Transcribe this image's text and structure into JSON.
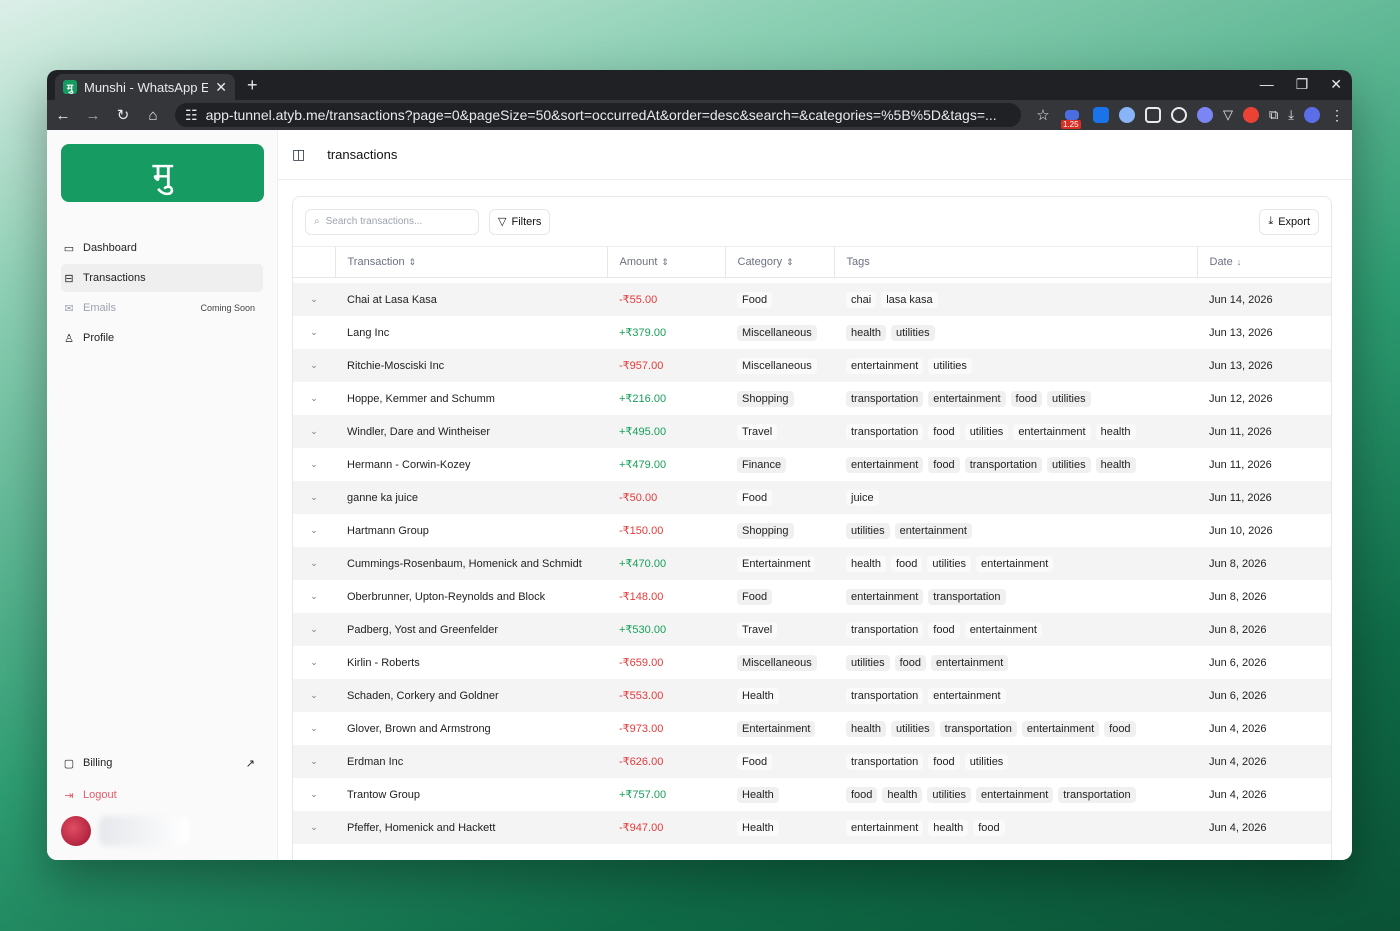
{
  "browser": {
    "tab_title": "Munshi - WhatsApp E",
    "favicon_letter": "मु",
    "url": "app-tunnel.atyb.me/transactions?page=0&pageSize=50&sort=occurredAt&order=desc&search=&categories=%5B%5D&tags=...",
    "ext_badge": "1.25"
  },
  "sidebar": {
    "logo": "मु",
    "items": [
      {
        "label": "Dashboard",
        "icon": "wallet-icon"
      },
      {
        "label": "Transactions",
        "icon": "receipt-icon"
      },
      {
        "label": "Emails",
        "icon": "mail-icon",
        "badge": "Coming Soon"
      },
      {
        "label": "Profile",
        "icon": "user-icon"
      }
    ],
    "billing": "Billing",
    "logout": "Logout"
  },
  "header": {
    "title": "transactions"
  },
  "toolbar": {
    "search_placeholder": "Search transactions...",
    "filters": "Filters",
    "export": "Export"
  },
  "table": {
    "columns": [
      "Transaction",
      "Amount",
      "Category",
      "Tags",
      "Date"
    ],
    "rows": [
      {
        "name": "Chai at Lasa Kasa",
        "amount": "-₹55.00",
        "sign": "neg",
        "category": "Food",
        "tags": [
          "chai",
          "lasa kasa"
        ],
        "date": "Jun 14, 2026"
      },
      {
        "name": "Lang Inc",
        "amount": "+₹379.00",
        "sign": "pos",
        "category": "Miscellaneous",
        "tags": [
          "health",
          "utilities"
        ],
        "date": "Jun 13, 2026"
      },
      {
        "name": "Ritchie-Mosciski Inc",
        "amount": "-₹957.00",
        "sign": "neg",
        "category": "Miscellaneous",
        "tags": [
          "entertainment",
          "utilities"
        ],
        "date": "Jun 13, 2026"
      },
      {
        "name": "Hoppe, Kemmer and Schumm",
        "amount": "+₹216.00",
        "sign": "pos",
        "category": "Shopping",
        "tags": [
          "transportation",
          "entertainment",
          "food",
          "utilities"
        ],
        "date": "Jun 12, 2026"
      },
      {
        "name": "Windler, Dare and Wintheiser",
        "amount": "+₹495.00",
        "sign": "pos",
        "category": "Travel",
        "tags": [
          "transportation",
          "food",
          "utilities",
          "entertainment",
          "health"
        ],
        "date": "Jun 11, 2026"
      },
      {
        "name": "Hermann - Corwin-Kozey",
        "amount": "+₹479.00",
        "sign": "pos",
        "category": "Finance",
        "tags": [
          "entertainment",
          "food",
          "transportation",
          "utilities",
          "health"
        ],
        "date": "Jun 11, 2026"
      },
      {
        "name": "ganne ka juice",
        "amount": "-₹50.00",
        "sign": "neg",
        "category": "Food",
        "tags": [
          "juice"
        ],
        "date": "Jun 11, 2026"
      },
      {
        "name": "Hartmann Group",
        "amount": "-₹150.00",
        "sign": "neg",
        "category": "Shopping",
        "tags": [
          "utilities",
          "entertainment"
        ],
        "date": "Jun 10, 2026"
      },
      {
        "name": "Cummings-Rosenbaum, Homenick and Schmidt",
        "amount": "+₹470.00",
        "sign": "pos",
        "category": "Entertainment",
        "tags": [
          "health",
          "food",
          "utilities",
          "entertainment"
        ],
        "date": "Jun 8, 2026"
      },
      {
        "name": "Oberbrunner, Upton-Reynolds and Block",
        "amount": "-₹148.00",
        "sign": "neg",
        "category": "Food",
        "tags": [
          "entertainment",
          "transportation"
        ],
        "date": "Jun 8, 2026"
      },
      {
        "name": "Padberg, Yost and Greenfelder",
        "amount": "+₹530.00",
        "sign": "pos",
        "category": "Travel",
        "tags": [
          "transportation",
          "food",
          "entertainment"
        ],
        "date": "Jun 8, 2026"
      },
      {
        "name": "Kirlin - Roberts",
        "amount": "-₹659.00",
        "sign": "neg",
        "category": "Miscellaneous",
        "tags": [
          "utilities",
          "food",
          "entertainment"
        ],
        "date": "Jun 6, 2026"
      },
      {
        "name": "Schaden, Corkery and Goldner",
        "amount": "-₹553.00",
        "sign": "neg",
        "category": "Health",
        "tags": [
          "transportation",
          "entertainment"
        ],
        "date": "Jun 6, 2026"
      },
      {
        "name": "Glover, Brown and Armstrong",
        "amount": "-₹973.00",
        "sign": "neg",
        "category": "Entertainment",
        "tags": [
          "health",
          "utilities",
          "transportation",
          "entertainment",
          "food"
        ],
        "date": "Jun 4, 2026"
      },
      {
        "name": "Erdman Inc",
        "amount": "-₹626.00",
        "sign": "neg",
        "category": "Food",
        "tags": [
          "transportation",
          "food",
          "utilities"
        ],
        "date": "Jun 4, 2026"
      },
      {
        "name": "Trantow Group",
        "amount": "+₹757.00",
        "sign": "pos",
        "category": "Health",
        "tags": [
          "food",
          "health",
          "utilities",
          "entertainment",
          "transportation"
        ],
        "date": "Jun 4, 2026"
      },
      {
        "name": "Pfeffer, Homenick and Hackett",
        "amount": "-₹947.00",
        "sign": "neg",
        "category": "Health",
        "tags": [
          "entertainment",
          "health",
          "food"
        ],
        "date": "Jun 4, 2026"
      }
    ]
  },
  "colors": {
    "brand": "#169b62",
    "negative": "#e23b3b",
    "positive": "#18a058"
  }
}
